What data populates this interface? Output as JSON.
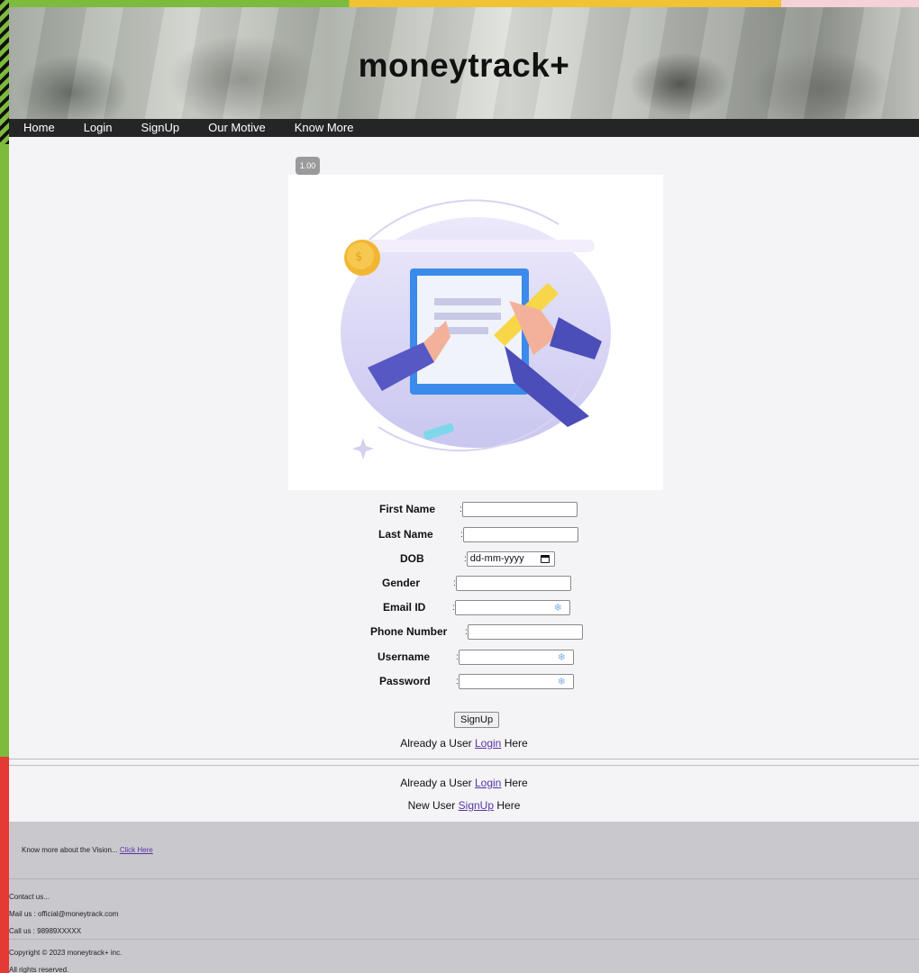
{
  "site": {
    "title": "moneytrack+"
  },
  "nav": {
    "items": [
      "Home",
      "Login",
      "SignUp",
      "Our Motive",
      "Know More"
    ]
  },
  "image_badge": "1.00",
  "form": {
    "first_name": {
      "label": "First Name",
      "colon": ":",
      "value": ""
    },
    "last_name": {
      "label": "Last Name",
      "colon": ":",
      "value": ""
    },
    "dob": {
      "label": "DOB",
      "colon": ":",
      "placeholder": "dd-mm-yyyy"
    },
    "gender": {
      "label": "Gender",
      "colon": ":",
      "value": ""
    },
    "email": {
      "label": "Email ID",
      "colon": ":",
      "value": ""
    },
    "phone": {
      "label": "Phone Number",
      "colon": ":",
      "value": ""
    },
    "username": {
      "label": "Username",
      "colon": ":",
      "value": ""
    },
    "password": {
      "label": "Password",
      "colon": ":",
      "value": ""
    },
    "submit_label": "SignUp"
  },
  "links": {
    "already_prefix": "Already a User",
    "login_link": "Login",
    "already_suffix": "Here",
    "new_prefix": "New User",
    "signup_link": "SignUp",
    "new_suffix": "Here"
  },
  "footer": {
    "vision_text": "Know more about the Vision...",
    "vision_link": "Click Here",
    "contact_title": "Contact us...",
    "mail": "Mail us : official@moneytrack.com",
    "call": "Call us : 98989XXXXX",
    "copyright": "Copyright © 2023 moneytrack+ inc.",
    "rights": "All rights reserved."
  },
  "colors": {
    "link": "#5a33a6",
    "nav_bg": "#252525",
    "footer_bg": "#c9c8cc"
  }
}
